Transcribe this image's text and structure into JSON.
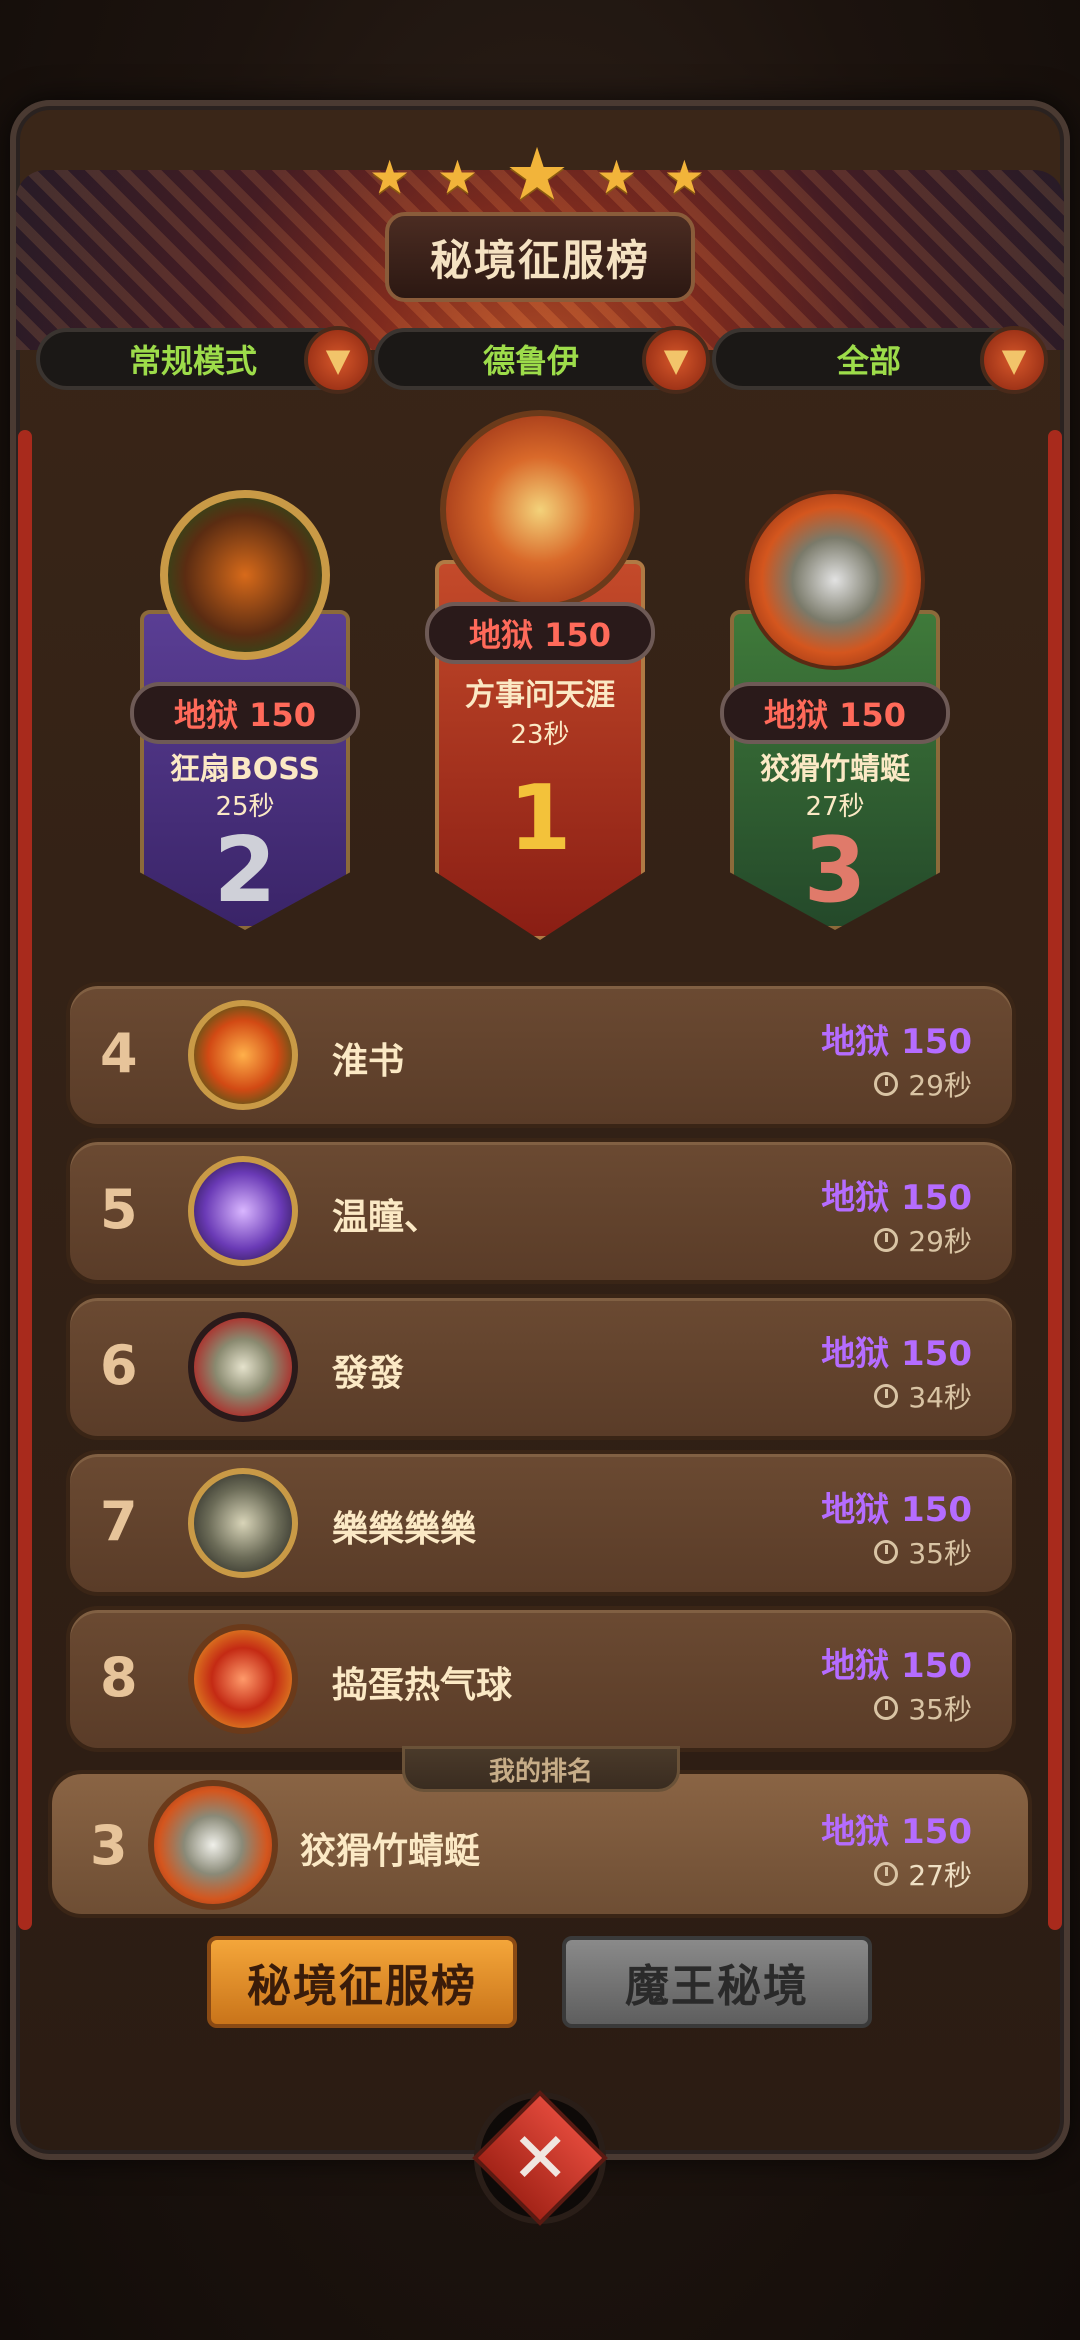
{
  "header": {
    "title": "秘境征服榜"
  },
  "filters": [
    {
      "label": "常规模式"
    },
    {
      "label": "德鲁伊"
    },
    {
      "label": "全部"
    }
  ],
  "podium": {
    "first": {
      "level": "地狱 150",
      "name": "方事问天涯",
      "time": "23秒",
      "rank": "1"
    },
    "second": {
      "level": "地狱 150",
      "name": "狂扇BOSS",
      "time": "25秒",
      "rank": "2"
    },
    "third": {
      "level": "地狱 150",
      "name": "狡猾竹蜻蜓",
      "time": "27秒",
      "rank": "3"
    }
  },
  "rows": [
    {
      "rank": "4",
      "name": "淮书",
      "level": "地狱 150",
      "time": "29秒"
    },
    {
      "rank": "5",
      "name": "温瞳、",
      "level": "地狱 150",
      "time": "29秒"
    },
    {
      "rank": "6",
      "name": "發發",
      "level": "地狱 150",
      "time": "34秒"
    },
    {
      "rank": "7",
      "name": "樂樂樂樂",
      "level": "地狱 150",
      "time": "35秒"
    },
    {
      "rank": "8",
      "name": "捣蛋热气球",
      "level": "地狱 150",
      "time": "35秒"
    }
  ],
  "my_rank": {
    "tag": "我的排名",
    "rank": "3",
    "name": "狡猾竹蜻蜓",
    "level": "地狱 150",
    "time": "27秒"
  },
  "tabs": {
    "active": "秘境征服榜",
    "inactive": "魔王秘境"
  },
  "colors": {
    "level_purple": "#b56cff",
    "level_red": "#ff6a5a",
    "filter_green": "#9ddc4a",
    "accent_orange": "#f4a63a"
  }
}
